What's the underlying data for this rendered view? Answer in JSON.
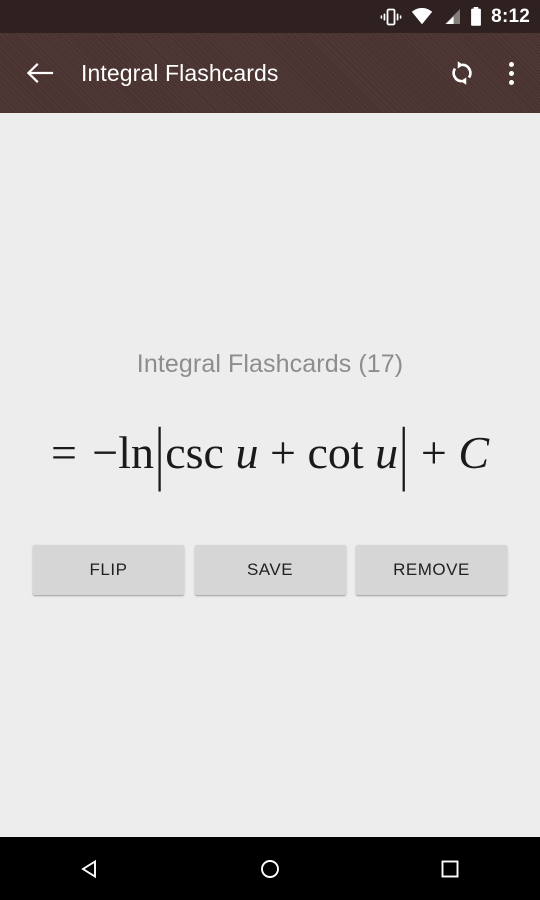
{
  "status_bar": {
    "time": "8:12",
    "icons": [
      {
        "name": "vibrate-icon",
        "label": "vibrate"
      },
      {
        "name": "wifi-icon",
        "label": "wifi"
      },
      {
        "name": "cellular-signal-icon",
        "label": "cellular signal"
      },
      {
        "name": "battery-icon",
        "label": "battery"
      }
    ],
    "background_color": "#2e2120"
  },
  "app_bar": {
    "title": "Integral Flashcards",
    "back_icon": "arrow-back-icon",
    "refresh_icon": "refresh-icon",
    "overflow_icon": "overflow-menu-icon",
    "background_color": "#4a3330",
    "text_color": "#ffffff"
  },
  "card": {
    "deck_title": "Integral Flashcards (17)",
    "deck_name": "Integral Flashcards",
    "card_count": "17",
    "formula": {
      "full_text": "= −ln|csc u + cot u| + C",
      "equals": "=",
      "minus": "−",
      "ln": "ln",
      "open_bar": "|",
      "csc": "csc",
      "var1": "u",
      "plus1": "+",
      "cot": "cot",
      "var2": "u",
      "close_bar": "|",
      "plus2": "+",
      "constant": "C"
    },
    "title_color": "#8d8d8d",
    "formula_color": "#1a1a1a",
    "background_color": "#ededed"
  },
  "buttons": {
    "flip": "FLIP",
    "save": "SAVE",
    "remove": "REMOVE",
    "background_color": "#d6d6d6",
    "text_color": "#212121"
  },
  "nav_bar": {
    "back": "back-nav",
    "home": "home-nav",
    "recents": "recents-nav",
    "background_color": "#000000"
  }
}
